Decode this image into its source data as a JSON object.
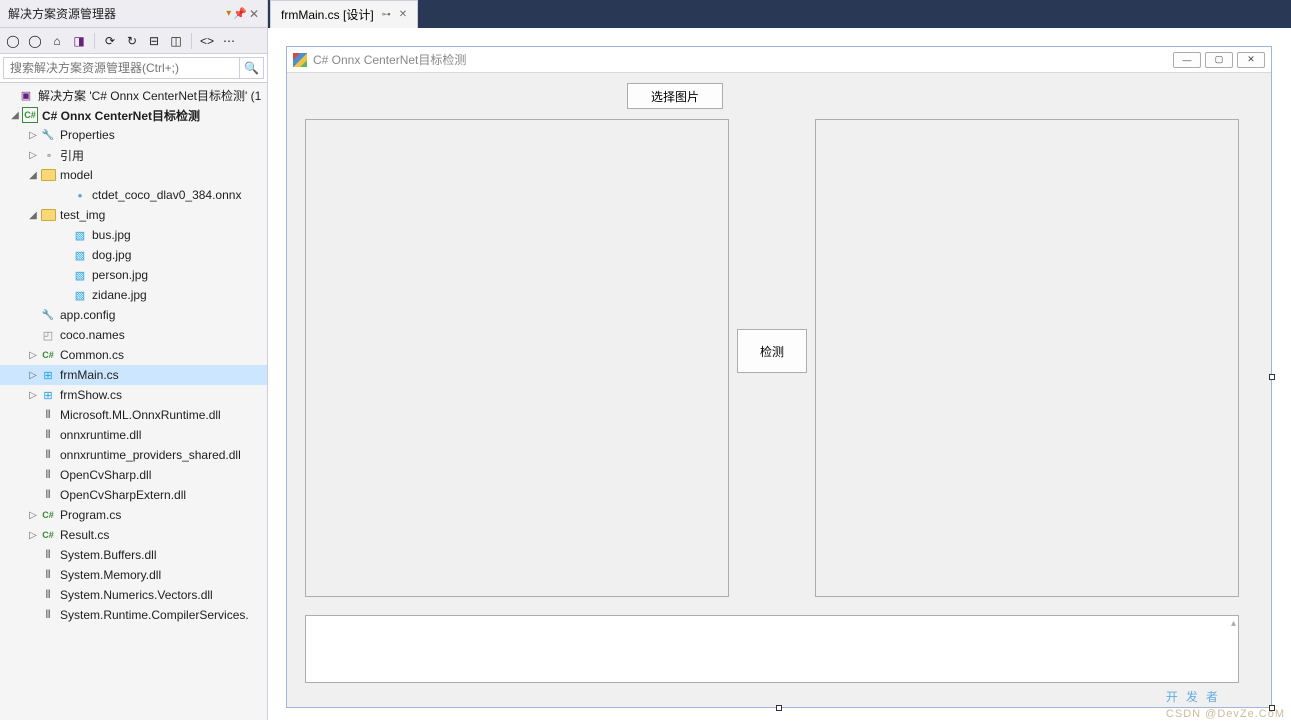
{
  "solutionExplorer": {
    "title": "解决方案资源管理器",
    "searchPlaceholder": "搜索解决方案资源管理器(Ctrl+;)",
    "solutionLabel": "解决方案 'C# Onnx CenterNet目标检测' (1",
    "projectLabel": "C# Onnx CenterNet目标检测",
    "nodes": {
      "properties": "Properties",
      "references": "引用",
      "model": "model",
      "model_file": "ctdet_coco_dlav0_384.onnx",
      "test_img": "test_img",
      "imgs": [
        "bus.jpg",
        "dog.jpg",
        "person.jpg",
        "zidane.jpg"
      ],
      "files": [
        {
          "icon": "wrench-icon",
          "label": "app.config"
        },
        {
          "icon": "file-icon",
          "label": "coco.names"
        },
        {
          "icon": "cs-icon",
          "label": "Common.cs",
          "expander": "▷"
        },
        {
          "icon": "form-icon",
          "label": "frmMain.cs",
          "expander": "▷",
          "selected": true
        },
        {
          "icon": "form-icon",
          "label": "frmShow.cs",
          "expander": "▷"
        },
        {
          "icon": "dll-icon",
          "label": "Microsoft.ML.OnnxRuntime.dll"
        },
        {
          "icon": "dll-icon",
          "label": "onnxruntime.dll"
        },
        {
          "icon": "dll-icon",
          "label": "onnxruntime_providers_shared.dll"
        },
        {
          "icon": "dll-icon",
          "label": "OpenCvSharp.dll"
        },
        {
          "icon": "dll-icon",
          "label": "OpenCvSharpExtern.dll"
        },
        {
          "icon": "cs-icon",
          "label": "Program.cs",
          "expander": "▷"
        },
        {
          "icon": "cs-icon",
          "label": "Result.cs",
          "expander": "▷"
        },
        {
          "icon": "dll-icon",
          "label": "System.Buffers.dll"
        },
        {
          "icon": "dll-icon",
          "label": "System.Memory.dll"
        },
        {
          "icon": "dll-icon",
          "label": "System.Numerics.Vectors.dll"
        },
        {
          "icon": "dll-icon",
          "label": "System.Runtime.CompilerServices."
        }
      ]
    }
  },
  "docTabs": {
    "active": "frmMain.cs [设计]"
  },
  "designer": {
    "formTitle": "C# Onnx CenterNet目标检测",
    "selectImageBtn": "选择图片",
    "detectBtn": "检测"
  },
  "watermark": {
    "main": "开发者",
    "sub": "CSDN @DevZe.CoM"
  }
}
